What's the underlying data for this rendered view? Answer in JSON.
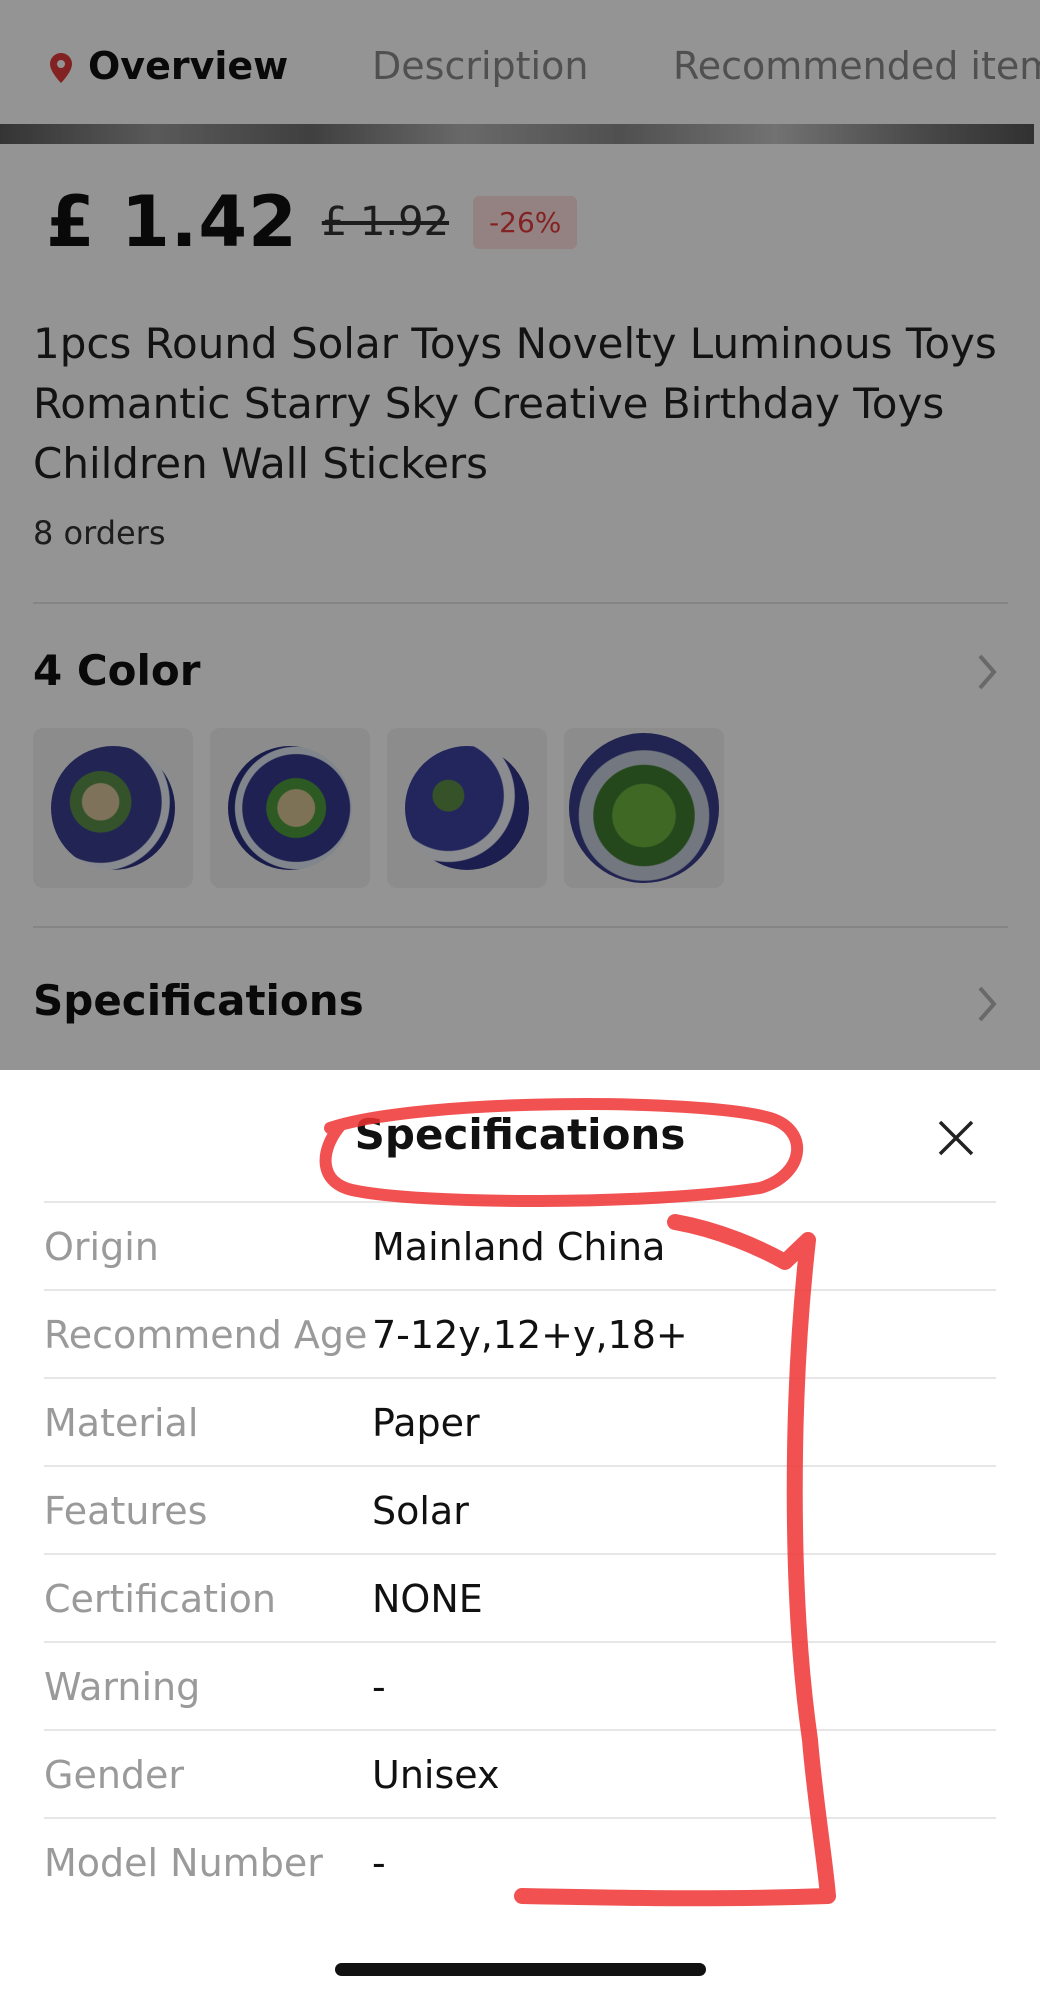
{
  "tabs": [
    {
      "label": "Overview",
      "active": true
    },
    {
      "label": "Description",
      "active": false
    },
    {
      "label": "Recommended item",
      "active": false
    }
  ],
  "product": {
    "price": "£ 1.42",
    "original_price": "£ 1.92",
    "discount": "-26%",
    "title": "1pcs Round Solar Toys Novelty Luminous Toys Romantic Starry Sky Creative Birthday Toys Children Wall Stickers",
    "orders": "8 orders"
  },
  "color_section": {
    "title": "4 Color",
    "swatch_count": 4
  },
  "specifications_section": {
    "title": "Specifications"
  },
  "sheet": {
    "title": "Specifications",
    "rows": [
      {
        "label": "Origin",
        "value": "Mainland China"
      },
      {
        "label": "Recommend Age",
        "value": "7-12y,12+y,18+"
      },
      {
        "label": "Material",
        "value": "Paper"
      },
      {
        "label": "Features",
        "value": "Solar"
      },
      {
        "label": "Certification",
        "value": "NONE"
      },
      {
        "label": "Warning",
        "value": "-"
      },
      {
        "label": "Gender",
        "value": "Unisex"
      },
      {
        "label": "Model Number",
        "value": "-"
      }
    ]
  },
  "colors": {
    "accent": "#e23b3b",
    "annotation": "#f03232",
    "overlay": "rgba(0,0,0,0.42)"
  },
  "icons": {
    "tab_pin": "location-pin-icon",
    "chevron": "chevron-right-icon",
    "close": "close-icon"
  }
}
